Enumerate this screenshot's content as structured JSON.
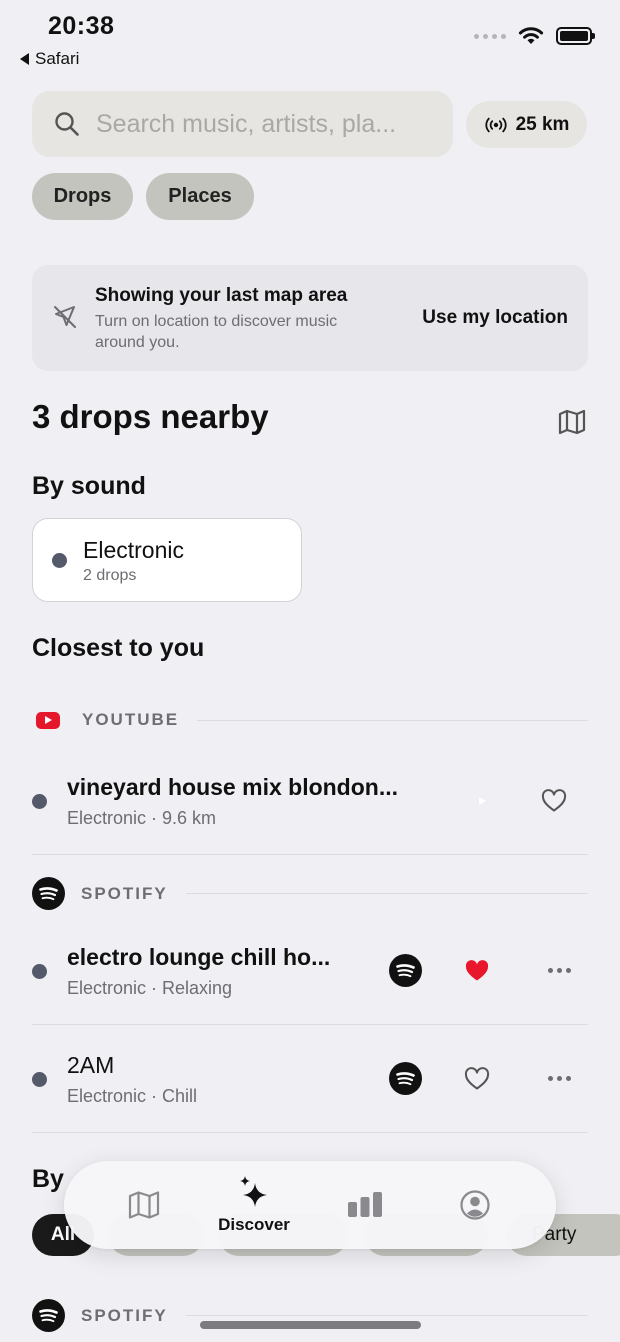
{
  "status": {
    "time": "20:38",
    "back_app": "Safari"
  },
  "search": {
    "placeholder": "Search music, artists, pla...",
    "radius": "25 km"
  },
  "filters": [
    "Drops",
    "Places"
  ],
  "location_banner": {
    "title": "Showing your last map area",
    "subtitle": "Turn on location to discover music around you.",
    "action": "Use my location"
  },
  "nearby_heading": "3 drops nearby",
  "by_sound": {
    "heading": "By sound",
    "card": {
      "name": "Electronic",
      "count": "2 drops"
    }
  },
  "closest": {
    "heading": "Closest to you",
    "sections": [
      {
        "label": "YOUTUBE",
        "tracks": [
          {
            "title": "vineyard house mix blondon...",
            "subtitle": "Electronic · 9.6 km",
            "liked": false
          }
        ]
      },
      {
        "label": "SPOTIFY",
        "tracks": [
          {
            "title": "electro lounge chill ho...",
            "subtitle": "Electronic · Relaxing",
            "liked": true
          },
          {
            "title": "2AM",
            "subtitle": "Electronic · Chill",
            "liked": false
          }
        ]
      }
    ]
  },
  "by_mood": {
    "heading_partial": "By",
    "chips": [
      "All",
      "Party"
    ]
  },
  "bottom_section": {
    "label": "SPOTIFY"
  },
  "tabbar": {
    "items": [
      {
        "icon": "map-icon",
        "label": ""
      },
      {
        "icon": "sparkles-icon",
        "label": "Discover",
        "active": true
      },
      {
        "icon": "bar-chart-icon",
        "label": ""
      },
      {
        "icon": "profile-icon",
        "label": ""
      }
    ]
  },
  "colors": {
    "background": "#f0eff3",
    "youtube_red": "#e4172b",
    "heart_red": "#e8172c",
    "genre_dot": "#555a6a"
  }
}
